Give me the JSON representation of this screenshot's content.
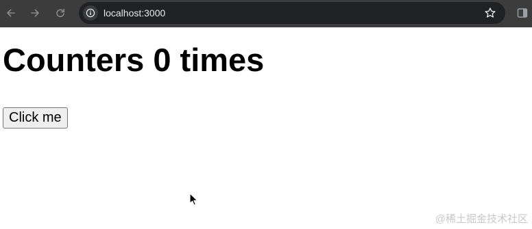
{
  "browser": {
    "url": "localhost:3000",
    "icons": {
      "back": "arrow-left-icon",
      "forward": "arrow-right-icon",
      "reload": "reload-icon",
      "site_info": "info-icon",
      "bookmark": "star-icon",
      "side_panel": "side-panel-icon"
    }
  },
  "page": {
    "heading": "Counters 0 times",
    "button_label": "Click me"
  },
  "watermark": "@稀土掘金技术社区"
}
